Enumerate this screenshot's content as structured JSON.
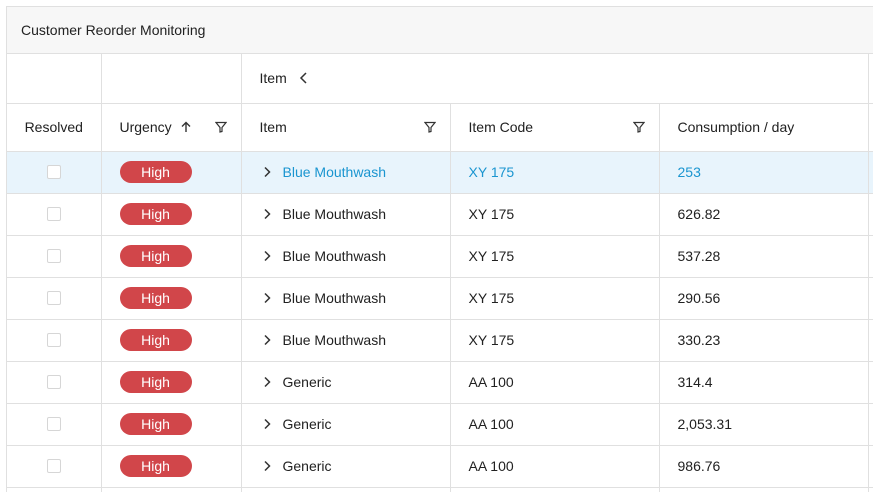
{
  "title": "Customer Reorder Monitoring",
  "group_header": {
    "label": "Item"
  },
  "columns": {
    "resolved": "Resolved",
    "urgency": "Urgency",
    "item": "Item",
    "item_code": "Item Code",
    "consumption": "Consumption / day"
  },
  "colors": {
    "badge": "#d1464a",
    "selected_bg": "#e8f4fc",
    "selected_text": "#1a95d0"
  },
  "rows": [
    {
      "urgency": "High",
      "item": "Blue Mouthwash",
      "item_code": "XY 175",
      "consumption": "253"
    },
    {
      "urgency": "High",
      "item": "Blue Mouthwash",
      "item_code": "XY 175",
      "consumption": "626.82"
    },
    {
      "urgency": "High",
      "item": "Blue Mouthwash",
      "item_code": "XY 175",
      "consumption": "537.28"
    },
    {
      "urgency": "High",
      "item": "Blue Mouthwash",
      "item_code": "XY 175",
      "consumption": "290.56"
    },
    {
      "urgency": "High",
      "item": "Blue Mouthwash",
      "item_code": "XY 175",
      "consumption": "330.23"
    },
    {
      "urgency": "High",
      "item": "Generic",
      "item_code": "AA 100",
      "consumption": "314.4"
    },
    {
      "urgency": "High",
      "item": "Generic",
      "item_code": "AA 100",
      "consumption": "2,053.31"
    },
    {
      "urgency": "High",
      "item": "Generic",
      "item_code": "AA 100",
      "consumption": "986.76"
    }
  ]
}
